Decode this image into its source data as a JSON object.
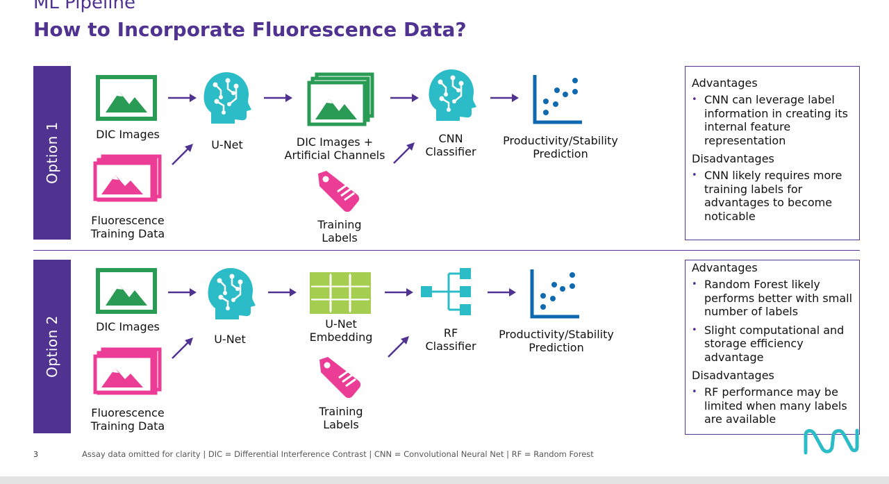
{
  "header": {
    "section": "ML Pipeline",
    "title": "How to Incorporate Fluorescence Data?"
  },
  "option1": {
    "tag": "Option 1",
    "dic_images": "DIC Images",
    "fluorescence": [
      "Fluorescence",
      "Training Data"
    ],
    "unet": "U-Net",
    "artificial": [
      "DIC Images +",
      "Artificial Channels"
    ],
    "labels": [
      "Training",
      "Labels"
    ],
    "classifier": [
      "CNN",
      "Classifier"
    ],
    "prediction": [
      "Productivity/Stability",
      "Prediction"
    ],
    "advantages_heading": "Advantages",
    "advantages": [
      "CNN can leverage label information in creating its internal feature representation"
    ],
    "disadvantages_heading": "Disadvantages",
    "disadvantages": [
      "CNN likely requires more training labels for advantages to become noticable"
    ]
  },
  "option2": {
    "tag": "Option 2",
    "dic_images": "DIC Images",
    "fluorescence": [
      "Fluorescence",
      "Training Data"
    ],
    "unet": "U-Net",
    "embedding": [
      "U-Net",
      "Embedding"
    ],
    "labels": [
      "Training",
      "Labels"
    ],
    "classifier": [
      "RF",
      "Classifier"
    ],
    "prediction": [
      "Productivity/Stability",
      "Prediction"
    ],
    "advantages_heading": "Advantages",
    "advantages": [
      "Random Forest likely performs better with small number of labels",
      "Slight computational and storage efficiency advantage"
    ],
    "disadvantages_heading": "Disadvantages",
    "disadvantages": [
      "RF performance may be limited when many labels are available"
    ]
  },
  "footer": {
    "page_number": "3",
    "note": "Assay data omitted for clarity | DIC = Differential Interference Contrast | CNN = Convolutional Neural Net | RF = Random Forest"
  },
  "colors": {
    "brand_purple": "#503291",
    "image_green": "#2A9B55",
    "fluor_pink": "#EB3C96",
    "teal": "#2BBCC8",
    "lime": "#A5CD50",
    "chart_blue": "#0F69AF"
  },
  "icons": [
    "image-icon",
    "image-stack-icon",
    "brain-icon",
    "tag-icon",
    "scatter-chart-icon",
    "grid-icon",
    "tree-icon",
    "arrow-icon",
    "logo-icon"
  ]
}
